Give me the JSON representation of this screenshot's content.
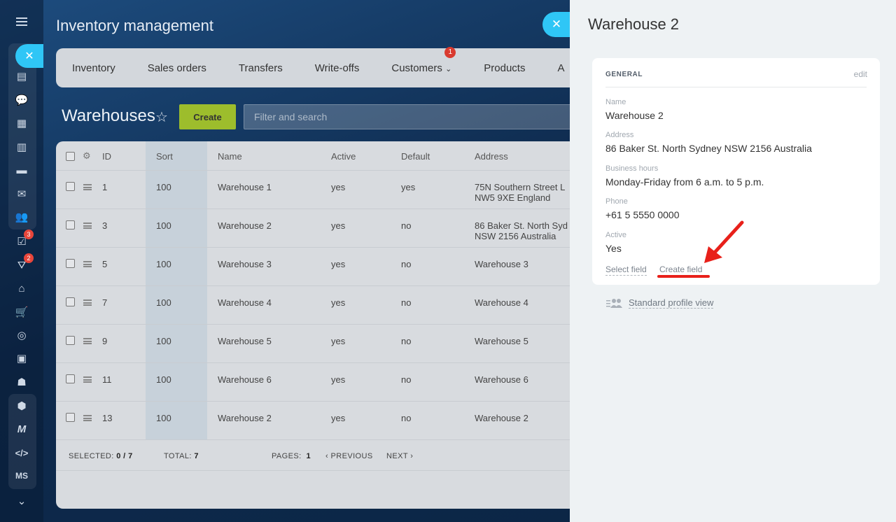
{
  "app": {
    "title": "Inventory management",
    "nav": [
      {
        "label": "Inventory"
      },
      {
        "label": "Sales orders"
      },
      {
        "label": "Transfers"
      },
      {
        "label": "Write-offs"
      },
      {
        "label": "Customers",
        "badge": "1",
        "dropdown": true
      },
      {
        "label": "Products"
      },
      {
        "label": "A"
      }
    ],
    "sidebar_badges": {
      "tasks": "3",
      "filter": "2"
    },
    "sidebar_text": {
      "ms": "MS"
    },
    "page_title": "Warehouses",
    "create_label": "Create",
    "filter_placeholder": "Filter and search",
    "grid": {
      "columns": [
        "ID",
        "Sort",
        "Name",
        "Active",
        "Default",
        "Address"
      ],
      "rows": [
        {
          "id": "1",
          "sort": "100",
          "name": "Warehouse 1",
          "active": "yes",
          "default": "yes",
          "address1": "75N Southern Street L",
          "address2": "NW5 9XE England"
        },
        {
          "id": "3",
          "sort": "100",
          "name": "Warehouse 2",
          "active": "yes",
          "default": "no",
          "address1": "86 Baker St. North Syd",
          "address2": "NSW 2156 Australia"
        },
        {
          "id": "5",
          "sort": "100",
          "name": "Warehouse 3",
          "active": "yes",
          "default": "no",
          "address1": "Warehouse 3",
          "address2": ""
        },
        {
          "id": "7",
          "sort": "100",
          "name": "Warehouse 4",
          "active": "yes",
          "default": "no",
          "address1": "Warehouse 4",
          "address2": ""
        },
        {
          "id": "9",
          "sort": "100",
          "name": "Warehouse 5",
          "active": "yes",
          "default": "no",
          "address1": "Warehouse 5",
          "address2": ""
        },
        {
          "id": "11",
          "sort": "100",
          "name": "Warehouse 6",
          "active": "yes",
          "default": "no",
          "address1": "Warehouse 6",
          "address2": ""
        },
        {
          "id": "13",
          "sort": "100",
          "name": "Warehouse 2",
          "active": "yes",
          "default": "no",
          "address1": "Warehouse 2",
          "address2": ""
        }
      ],
      "footer": {
        "selected_label": "SELECTED:",
        "selected_value": "0 / 7",
        "total_label": "TOTAL:",
        "total_value": "7",
        "pages_label": "PAGES:",
        "pages_value": "1",
        "previous": "PREVIOUS",
        "next": "NEXT"
      }
    }
  },
  "panel": {
    "title": "Warehouse 2",
    "section_title": "GENERAL",
    "edit": "edit",
    "fields": [
      {
        "label": "Name",
        "value": "Warehouse 2"
      },
      {
        "label": "Address",
        "value": "86 Baker St. North Sydney NSW 2156 Australia"
      },
      {
        "label": "Business hours",
        "value": "Monday-Friday from 6 a.m. to 5 p.m."
      },
      {
        "label": "Phone",
        "value": "+61 5 5550 0000"
      },
      {
        "label": "Active",
        "value": "Yes"
      }
    ],
    "select_field": "Select field",
    "create_field": "Create field",
    "standard_profile_view": "Standard profile view"
  },
  "colors": {
    "accent": "#2fc6f6",
    "create_button": "#9dbd2c",
    "annotation": "#e8201a"
  }
}
